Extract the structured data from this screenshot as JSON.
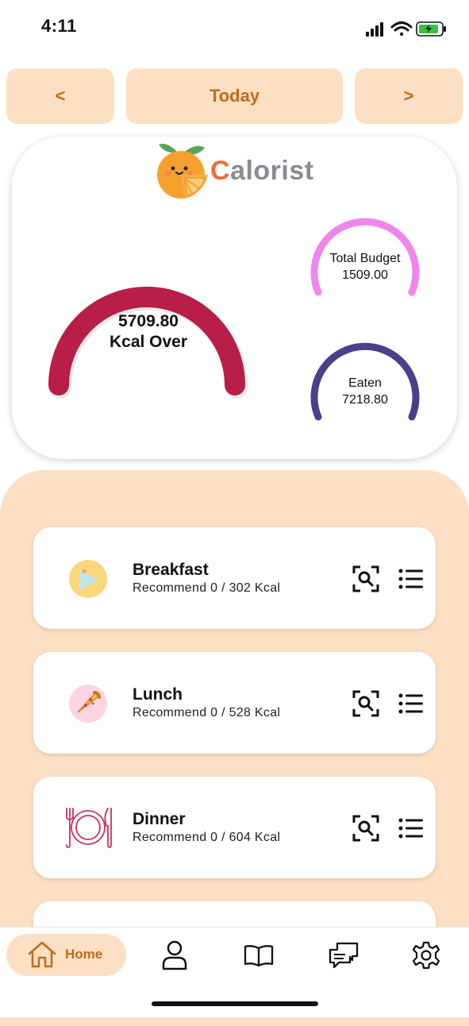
{
  "status_bar": {
    "time": "4:11"
  },
  "date_nav": {
    "prev_label": "<",
    "current_label": "Today",
    "next_label": ">"
  },
  "brand": {
    "name_first": "C",
    "name_rest": "alorist"
  },
  "summary": {
    "over_value": "5709.80",
    "over_label": "Kcal Over",
    "budget_label": "Total Budget",
    "budget_value": "1509.00",
    "eaten_label": "Eaten",
    "eaten_value": "7218.80"
  },
  "meals": [
    {
      "name": "Breakfast",
      "subtitle": "Recommend 0 / 302 Kcal",
      "icon": "sunrise-icon"
    },
    {
      "name": "Lunch",
      "subtitle": "Recommend 0 / 528 Kcal",
      "icon": "pizza-icon"
    },
    {
      "name": "Dinner",
      "subtitle": "Recommend 0 / 604 Kcal",
      "icon": "plate-cutlery-icon"
    }
  ],
  "bottom_nav": {
    "home_label": "Home"
  },
  "colors": {
    "accent": "#c06a1c",
    "accent_bg": "#fde0c3",
    "over_gauge": "#b81e47",
    "budget_gauge": "#ee86ee",
    "eaten_gauge": "#4a4089"
  }
}
